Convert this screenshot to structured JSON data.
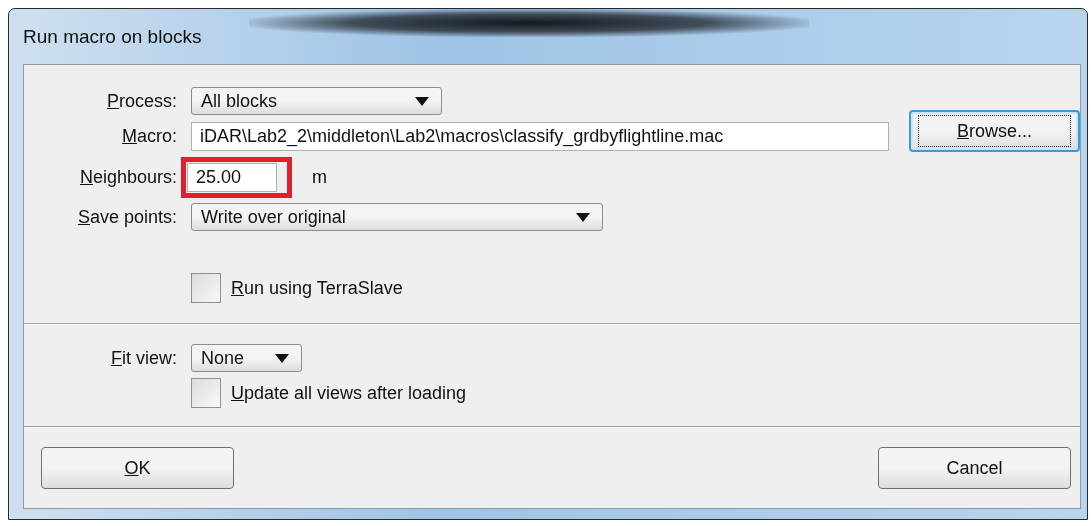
{
  "window": {
    "title": "Run macro on blocks"
  },
  "fields": [
    {
      "kind": "dropdown",
      "label": "Process:",
      "mnemonic": true,
      "value": "All blocks"
    },
    {
      "kind": "text",
      "label": "Macro:",
      "mnemonic": true,
      "value": "iDAR\\Lab2_2\\middleton\\Lab2\\macros\\classify_grdbyflightline.mac",
      "button": {
        "label": "Browse...",
        "mnemonic": true,
        "focused": true
      }
    },
    {
      "kind": "number",
      "label": "Neighbours:",
      "mnemonic": true,
      "value": "25.00",
      "unit": "m",
      "highlighted": true
    },
    {
      "kind": "dropdown",
      "label": "Save points:",
      "mnemonic": true,
      "value": "Write over original"
    }
  ],
  "run_option": {
    "label": "Run using TerraSlave",
    "mnemonic": true,
    "checked": false
  },
  "fit_view": {
    "label": "Fit view:",
    "mnemonic": true,
    "value": "None"
  },
  "update_option": {
    "label": "Update all views after loading",
    "mnemonic": true,
    "checked": false
  },
  "buttons": [
    {
      "label": "OK",
      "mnemonic": true
    },
    {
      "label": "Cancel",
      "mnemonic": false
    }
  ]
}
